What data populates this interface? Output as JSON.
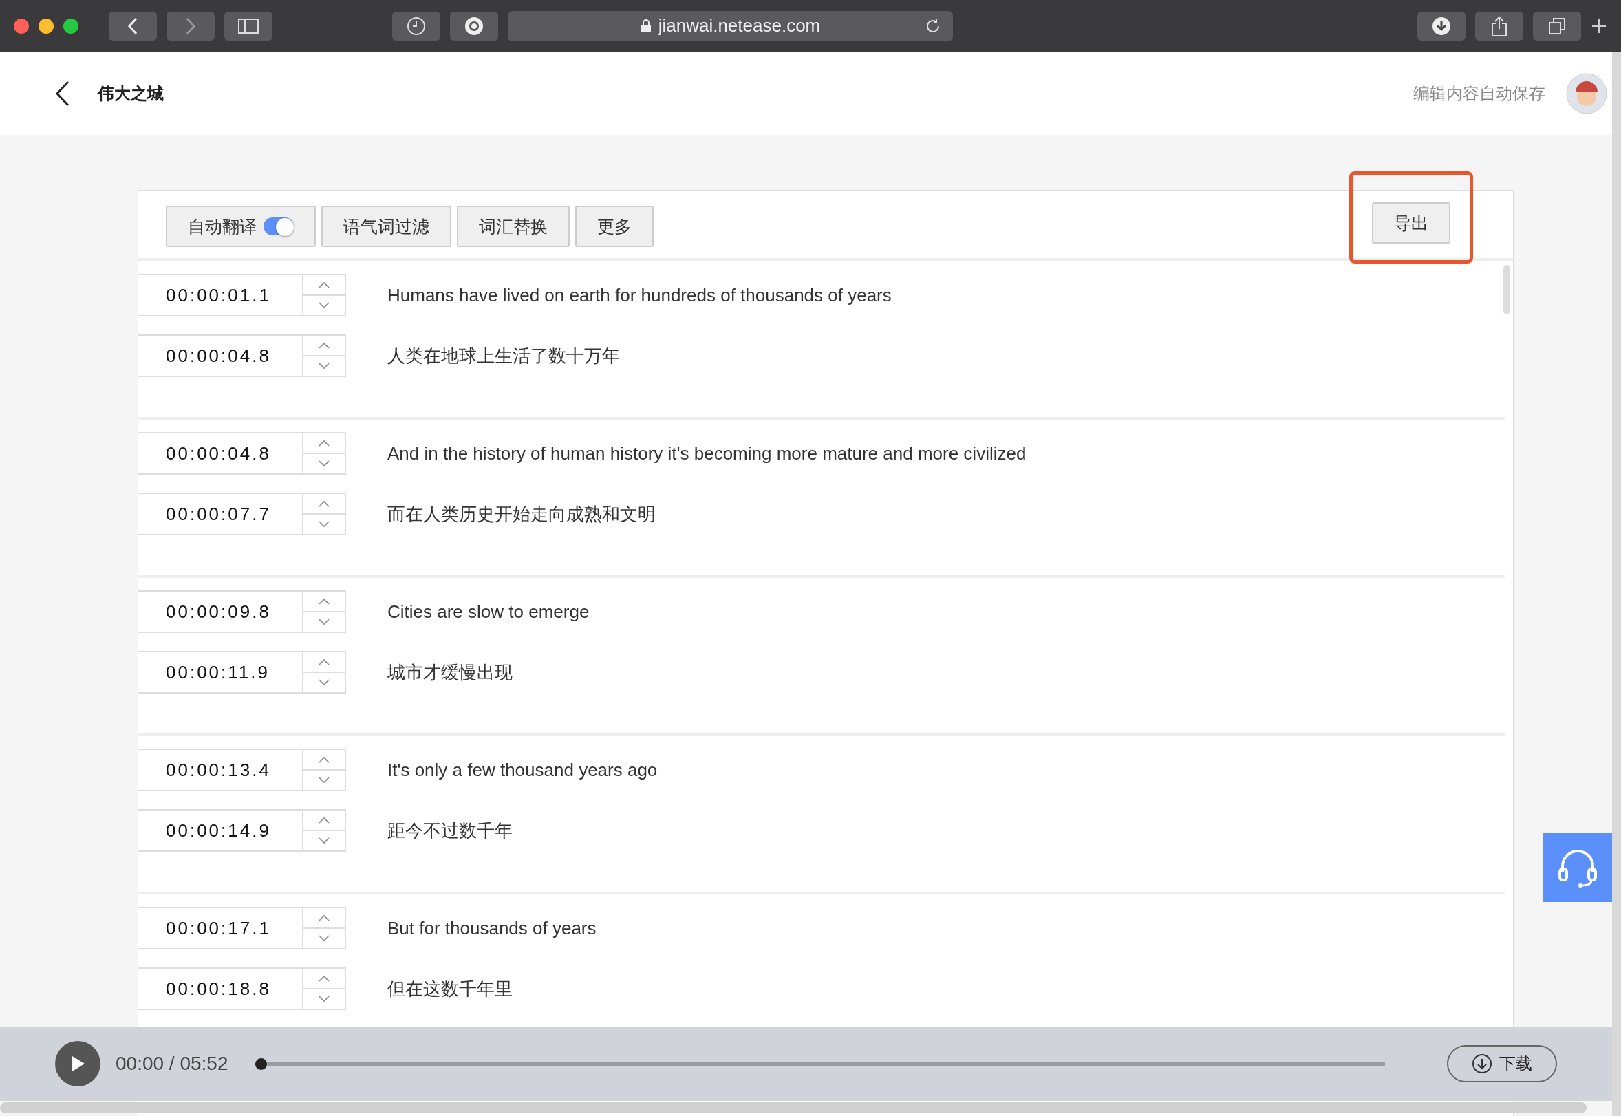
{
  "browser": {
    "url": "jianwai.netease.com"
  },
  "header": {
    "title": "伟大之城",
    "save_status": "编辑内容自动保存"
  },
  "toolbar": {
    "buttons": [
      {
        "label": "自动翻译",
        "kind": "toggle",
        "on": true
      },
      {
        "label": "语气词过滤",
        "kind": "plain"
      },
      {
        "label": "词汇替换",
        "kind": "plain"
      },
      {
        "label": "更多",
        "kind": "plain"
      }
    ],
    "export_label": "导出",
    "export_highlighted": true
  },
  "segments": [
    {
      "start": "00:00:01.1",
      "end": "00:00:04.8",
      "original": "Humans have lived on earth for hundreds of thousands of years",
      "translation": "人类在地球上生活了数十万年"
    },
    {
      "start": "00:00:04.8",
      "end": "00:00:07.7",
      "original": "And in the history of human history it's becoming more mature and more civilized",
      "translation": "而在人类历史开始走向成熟和文明"
    },
    {
      "start": "00:00:09.8",
      "end": "00:00:11.9",
      "original": "Cities are slow to emerge",
      "translation": "城市才缓慢出现"
    },
    {
      "start": "00:00:13.4",
      "end": "00:00:14.9",
      "original": "It's only a few thousand years ago",
      "translation": "距今不过数千年"
    },
    {
      "start": "00:00:17.1",
      "end": "00:00:18.8",
      "original": "But for thousands of years",
      "translation": "但在这数千年里"
    }
  ],
  "player": {
    "time": "00:00 / 05:52",
    "level": 0.0,
    "download_label": "下载"
  }
}
